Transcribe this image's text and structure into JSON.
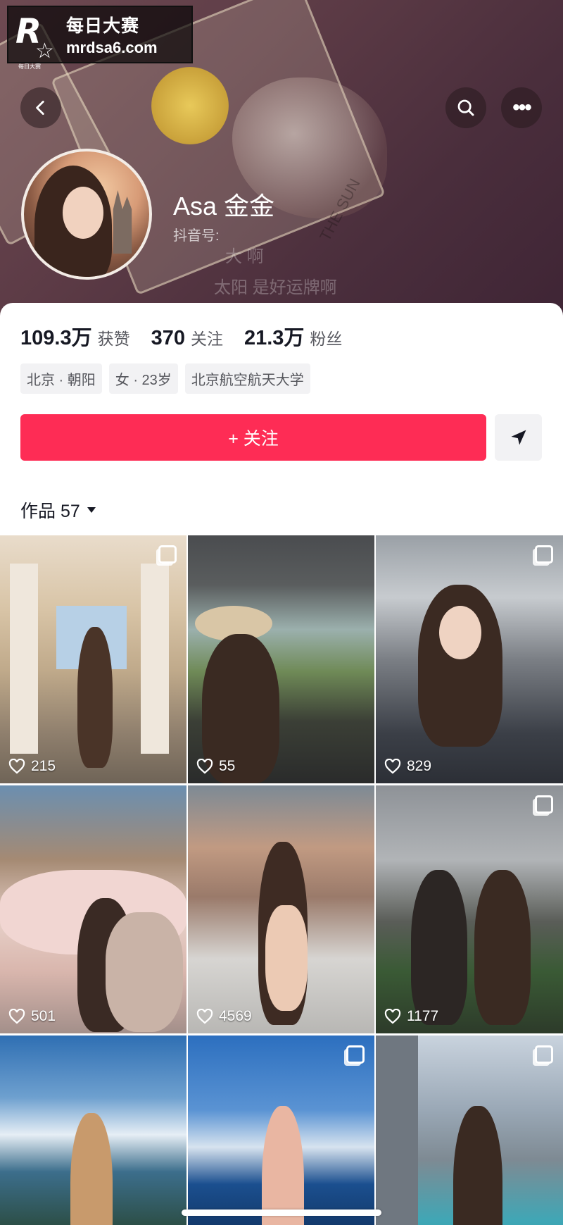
{
  "watermark": {
    "logo": "R",
    "logo_small": "每日大赛",
    "line1": "每日大赛",
    "line2": "mrdsa6.com"
  },
  "header": {
    "back_icon": "chevron-left-icon",
    "search_icon": "search-icon",
    "more_icon": "more-dots-icon",
    "more_label": "•••"
  },
  "cover_overlay": {
    "line1": "大 啊",
    "line2": "太阳 是好运牌啊",
    "card_text": "THE SUN"
  },
  "profile": {
    "name": "Asa 金金",
    "douyin_id_label": "抖音号:",
    "stats": [
      {
        "value": "109.3万",
        "label": "获赞"
      },
      {
        "value": "370",
        "label": "关注"
      },
      {
        "value": "21.3万",
        "label": "粉丝"
      }
    ],
    "tags": [
      "北京 · 朝阳",
      "女 · 23岁",
      "北京航空航天大学"
    ],
    "follow_label": "+ 关注",
    "works_label": "作品 57"
  },
  "colors": {
    "accent": "#fe2c55",
    "tag_bg": "#f2f2f4"
  },
  "grid": [
    {
      "likes": "215",
      "multi": true
    },
    {
      "likes": "55",
      "multi": false
    },
    {
      "likes": "829",
      "multi": true
    },
    {
      "likes": "501",
      "multi": false
    },
    {
      "likes": "4569",
      "multi": false
    },
    {
      "likes": "1177",
      "multi": true
    },
    {
      "likes": "",
      "multi": false
    },
    {
      "likes": "",
      "multi": true
    },
    {
      "likes": "",
      "multi": true
    }
  ]
}
